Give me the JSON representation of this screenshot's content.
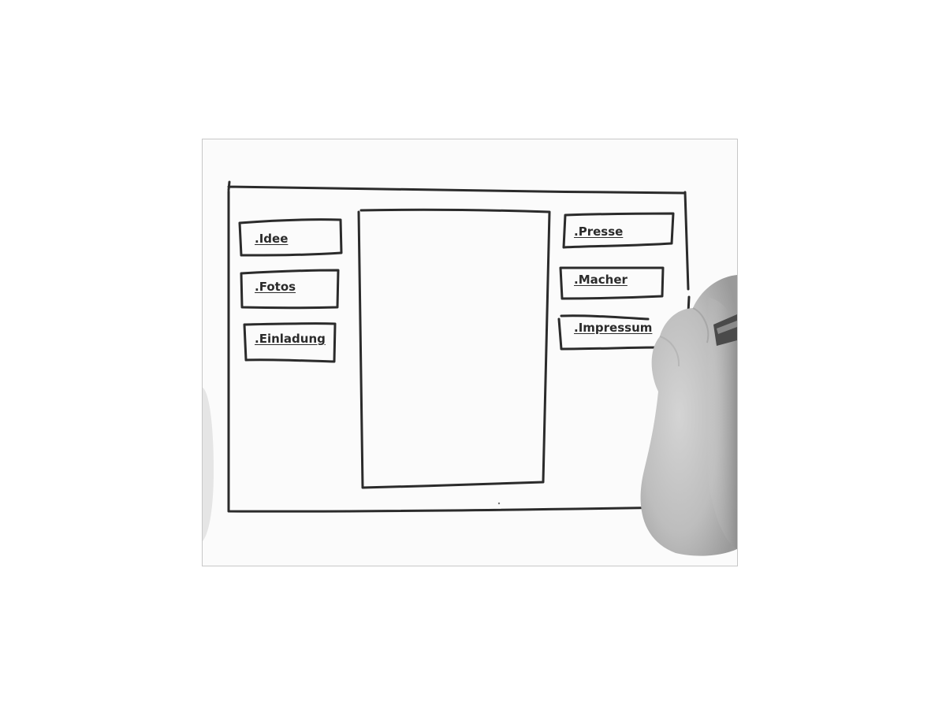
{
  "nav": {
    "left": [
      {
        "label": ".Idee"
      },
      {
        "label": ".Fotos"
      },
      {
        "label": ".Einladung"
      }
    ],
    "right": [
      {
        "label": ".Presse"
      },
      {
        "label": ".Macher"
      },
      {
        "label": ".Impressum"
      }
    ]
  },
  "colors": {
    "ink": "#2b2b2b",
    "paper": "#fbfbfb",
    "frame_border": "#c7c7c7"
  }
}
